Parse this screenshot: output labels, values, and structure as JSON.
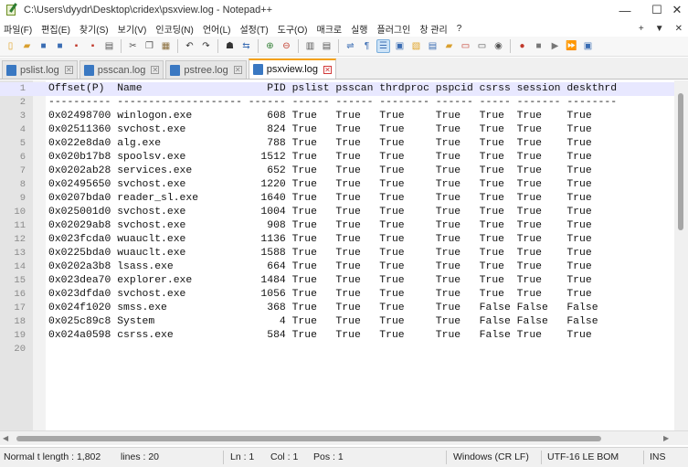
{
  "window": {
    "title": "C:\\Users\\dyydr\\Desktop\\cridex\\psxview.log - Notepad++",
    "minimize": "—",
    "maximize": "☐",
    "close": "✕"
  },
  "menu": [
    "파일(F)",
    "편집(E)",
    "찾기(S)",
    "보기(V)",
    "인코딩(N)",
    "언어(L)",
    "설정(T)",
    "도구(O)",
    "매크로",
    "실행",
    "플러그인",
    "창 관리",
    "?"
  ],
  "menu_right": {
    "plus": "+",
    "down": "▼",
    "close": "✕"
  },
  "toolbar": [
    {
      "icon": "new-file-icon",
      "glyph": "▯",
      "color": "#e0a020"
    },
    {
      "icon": "open-file-icon",
      "glyph": "▰",
      "color": "#d9a030"
    },
    {
      "icon": "save-icon",
      "glyph": "■",
      "color": "#3b6db3"
    },
    {
      "icon": "save-all-icon",
      "glyph": "■",
      "color": "#3b6db3"
    },
    {
      "icon": "close-icon",
      "glyph": "▪",
      "color": "#c0392b"
    },
    {
      "icon": "close-all-icon",
      "glyph": "▪",
      "color": "#c0392b"
    },
    {
      "icon": "print-icon",
      "glyph": "▤",
      "color": "#555555"
    },
    {
      "sep": true
    },
    {
      "icon": "cut-icon",
      "glyph": "✂",
      "color": "#555555"
    },
    {
      "icon": "copy-icon",
      "glyph": "❐",
      "color": "#555555"
    },
    {
      "icon": "paste-icon",
      "glyph": "▦",
      "color": "#8a6d3b"
    },
    {
      "sep": true
    },
    {
      "icon": "undo-icon",
      "glyph": "↶",
      "color": "#333333"
    },
    {
      "icon": "redo-icon",
      "glyph": "↷",
      "color": "#333333"
    },
    {
      "sep": true
    },
    {
      "icon": "find-icon",
      "glyph": "☗",
      "color": "#333333"
    },
    {
      "icon": "replace-icon",
      "glyph": "⇆",
      "color": "#3b6db3"
    },
    {
      "sep": true
    },
    {
      "icon": "zoom-in-icon",
      "glyph": "⊕",
      "color": "#2e7d32"
    },
    {
      "icon": "zoom-out-icon",
      "glyph": "⊖",
      "color": "#c0392b"
    },
    {
      "sep": true
    },
    {
      "icon": "sync-vertical-icon",
      "glyph": "▥",
      "color": "#555555"
    },
    {
      "icon": "sync-horizontal-icon",
      "glyph": "▤",
      "color": "#555555"
    },
    {
      "sep": true
    },
    {
      "icon": "word-wrap-icon",
      "glyph": "⇌",
      "color": "#3b6db3"
    },
    {
      "icon": "show-all-chars-icon",
      "glyph": "¶",
      "color": "#3b6db3"
    },
    {
      "icon": "indent-guide-icon",
      "glyph": "☰",
      "color": "#3b6db3",
      "active": true
    },
    {
      "icon": "udl-icon",
      "glyph": "▣",
      "color": "#3b6db3"
    },
    {
      "icon": "doc-map-icon",
      "glyph": "▧",
      "color": "#e0a020"
    },
    {
      "icon": "function-list-icon",
      "glyph": "▤",
      "color": "#3b6db3"
    },
    {
      "icon": "folder-workspace-icon",
      "glyph": "▰",
      "color": "#d9a030"
    },
    {
      "icon": "doc-list-icon",
      "glyph": "▭",
      "color": "#c0392b"
    },
    {
      "icon": "monitoring-icon",
      "glyph": "▭",
      "color": "#555555"
    },
    {
      "icon": "eye-icon",
      "glyph": "◉",
      "color": "#555555"
    },
    {
      "sep": true
    },
    {
      "icon": "record-macro-icon",
      "glyph": "●",
      "color": "#c0392b"
    },
    {
      "icon": "stop-macro-icon",
      "glyph": "■",
      "color": "#777777"
    },
    {
      "icon": "play-macro-icon",
      "glyph": "▶",
      "color": "#777777"
    },
    {
      "icon": "run-macro-multiple-icon",
      "glyph": "⏩",
      "color": "#3b6db3"
    },
    {
      "icon": "save-macro-icon",
      "glyph": "▣",
      "color": "#3b6db3"
    }
  ],
  "tabs": [
    {
      "label": "pslist.log",
      "active": false
    },
    {
      "label": "psscan.log",
      "active": false
    },
    {
      "label": "pstree.log",
      "active": false
    },
    {
      "label": "psxview.log",
      "active": true
    }
  ],
  "tab_close_glyph": "✕",
  "editor": {
    "lines": [
      {
        "n": "1",
        "text": "Offset(P)  Name                    PID pslist psscan thrdproc pspcid csrss session deskthrd"
      },
      {
        "n": "2",
        "text": "---------- -------------------- ------ ------ ------ -------- ------ ----- ------- --------"
      },
      {
        "n": "3",
        "text": "0x02498700 winlogon.exe            608 True   True   True     True   True  True    True"
      },
      {
        "n": "4",
        "text": "0x02511360 svchost.exe             824 True   True   True     True   True  True    True"
      },
      {
        "n": "5",
        "text": "0x022e8da0 alg.exe                 788 True   True   True     True   True  True    True"
      },
      {
        "n": "6",
        "text": "0x020b17b8 spoolsv.exe            1512 True   True   True     True   True  True    True"
      },
      {
        "n": "7",
        "text": "0x0202ab28 services.exe            652 True   True   True     True   True  True    True"
      },
      {
        "n": "8",
        "text": "0x02495650 svchost.exe            1220 True   True   True     True   True  True    True"
      },
      {
        "n": "9",
        "text": "0x0207bda0 reader_sl.exe          1640 True   True   True     True   True  True    True"
      },
      {
        "n": "10",
        "text": "0x025001d0 svchost.exe            1004 True   True   True     True   True  True    True"
      },
      {
        "n": "11",
        "text": "0x02029ab8 svchost.exe             908 True   True   True     True   True  True    True"
      },
      {
        "n": "12",
        "text": "0x023fcda0 wuauclt.exe            1136 True   True   True     True   True  True    True"
      },
      {
        "n": "13",
        "text": "0x0225bda0 wuauclt.exe            1588 True   True   True     True   True  True    True"
      },
      {
        "n": "14",
        "text": "0x0202a3b8 lsass.exe               664 True   True   True     True   True  True    True"
      },
      {
        "n": "15",
        "text": "0x023dea70 explorer.exe           1484 True   True   True     True   True  True    True"
      },
      {
        "n": "16",
        "text": "0x023dfda0 svchost.exe            1056 True   True   True     True   True  True    True"
      },
      {
        "n": "17",
        "text": "0x024f1020 smss.exe                368 True   True   True     True   False False   False"
      },
      {
        "n": "18",
        "text": "0x025c89c8 System                    4 True   True   True     True   False False   False"
      },
      {
        "n": "19",
        "text": "0x024a0598 csrss.exe               584 True   True   True     True   False True    True"
      },
      {
        "n": "20",
        "text": ""
      }
    ]
  },
  "status": {
    "mode_length": "Normal t length : 1,802",
    "lines": "lines : 20",
    "ln": "Ln : 1",
    "col": "Col : 1",
    "pos": "Pos : 1",
    "eol": "Windows (CR LF)",
    "encoding": "UTF-16 LE BOM",
    "insert": "INS"
  },
  "colors": {
    "current_line": "#e8e8ff",
    "active_tab_accent": "#f4a21d",
    "gutter": "#e4e4e4"
  }
}
